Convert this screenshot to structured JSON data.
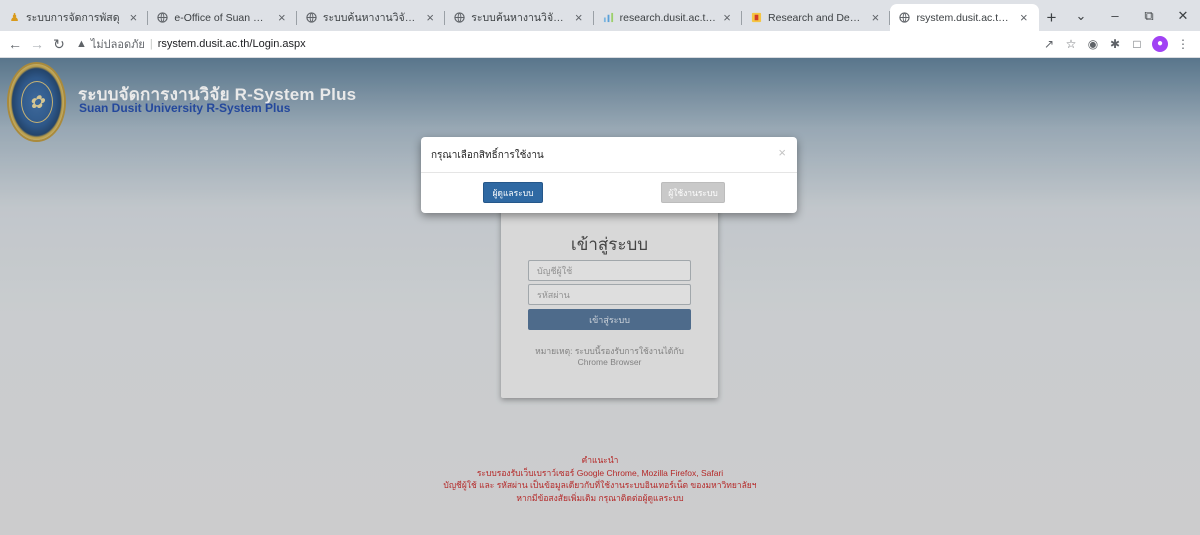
{
  "browser": {
    "tabs": [
      {
        "title": "ระบบการจัดการพัสดุ",
        "icon": "person-icon",
        "active": false
      },
      {
        "title": "e-Office of Suan Dusit Rajabhat",
        "icon": "globe-icon",
        "active": false
      },
      {
        "title": "ระบบค้นหางานวิจัย มหาวิทยาลัยสวนดุ",
        "icon": "globe-icon",
        "active": false
      },
      {
        "title": "ระบบค้นหางานวิจัย มหาวิทยาลัยสวนดุ",
        "icon": "globe-icon",
        "active": false
      },
      {
        "title": "research.dusit.ac.th สถาบันวิจัยและ",
        "icon": "research-icon",
        "active": false
      },
      {
        "title": "Research and Development Insti",
        "icon": "rdi-icon",
        "active": false
      },
      {
        "title": "rsystem.dusit.ac.th/Login.aspx",
        "icon": "globe-icon",
        "active": true
      }
    ],
    "tab_close_glyph": "×",
    "new_tab_glyph": "+",
    "window_controls": [
      "⌄",
      "–",
      "⧉",
      "✕"
    ],
    "address": {
      "security_label": "ไม่ปลอดภัย",
      "url": "rsystem.dusit.ac.th/Login.aspx"
    }
  },
  "header": {
    "title": "ระบบจัดการงานวิจัย R-System Plus",
    "subtitle": "Suan Dusit University R-System Plus"
  },
  "login": {
    "title": "เข้าสู่ระบบ",
    "username_placeholder": "บัญชีผู้ใช้",
    "password_placeholder": "รหัสผ่าน",
    "submit_label": "เข้าสู่ระบบ",
    "note": "หมายเหตุ: ระบบนี้รองรับการใช้งานได้กับ Chrome Browser"
  },
  "footer": {
    "lines": [
      "คำแนะนำ",
      "ระบบรองรับเว็บเบราว์เซอร์ Google Chrome, Mozilla Firefox, Safari",
      "บัญชีผู้ใช้ และ รหัสผ่าน เป็นข้อมูลเดียวกับที่ใช้งานระบบอินเทอร์เน็ต ของมหาวิทยาลัยฯ",
      "หากมีข้อสงสัยเพิ่มเติม กรุณาติดต่อผู้ดูแลระบบ"
    ]
  },
  "modal": {
    "title": "กรุณาเลือกสิทธิ์การใช้งาน",
    "close_glyph": "×",
    "admin_button": "ผู้ดูแลระบบ",
    "user_button": "ผู้ใช้งานระบบ"
  },
  "colors": {
    "header_title": "#ffffff",
    "header_subtitle": "#1f48a8",
    "login_button": "#4f7095",
    "admin_button": "#2f69a3",
    "user_button": "#c9c9c9",
    "footer_text": "#c42424"
  }
}
